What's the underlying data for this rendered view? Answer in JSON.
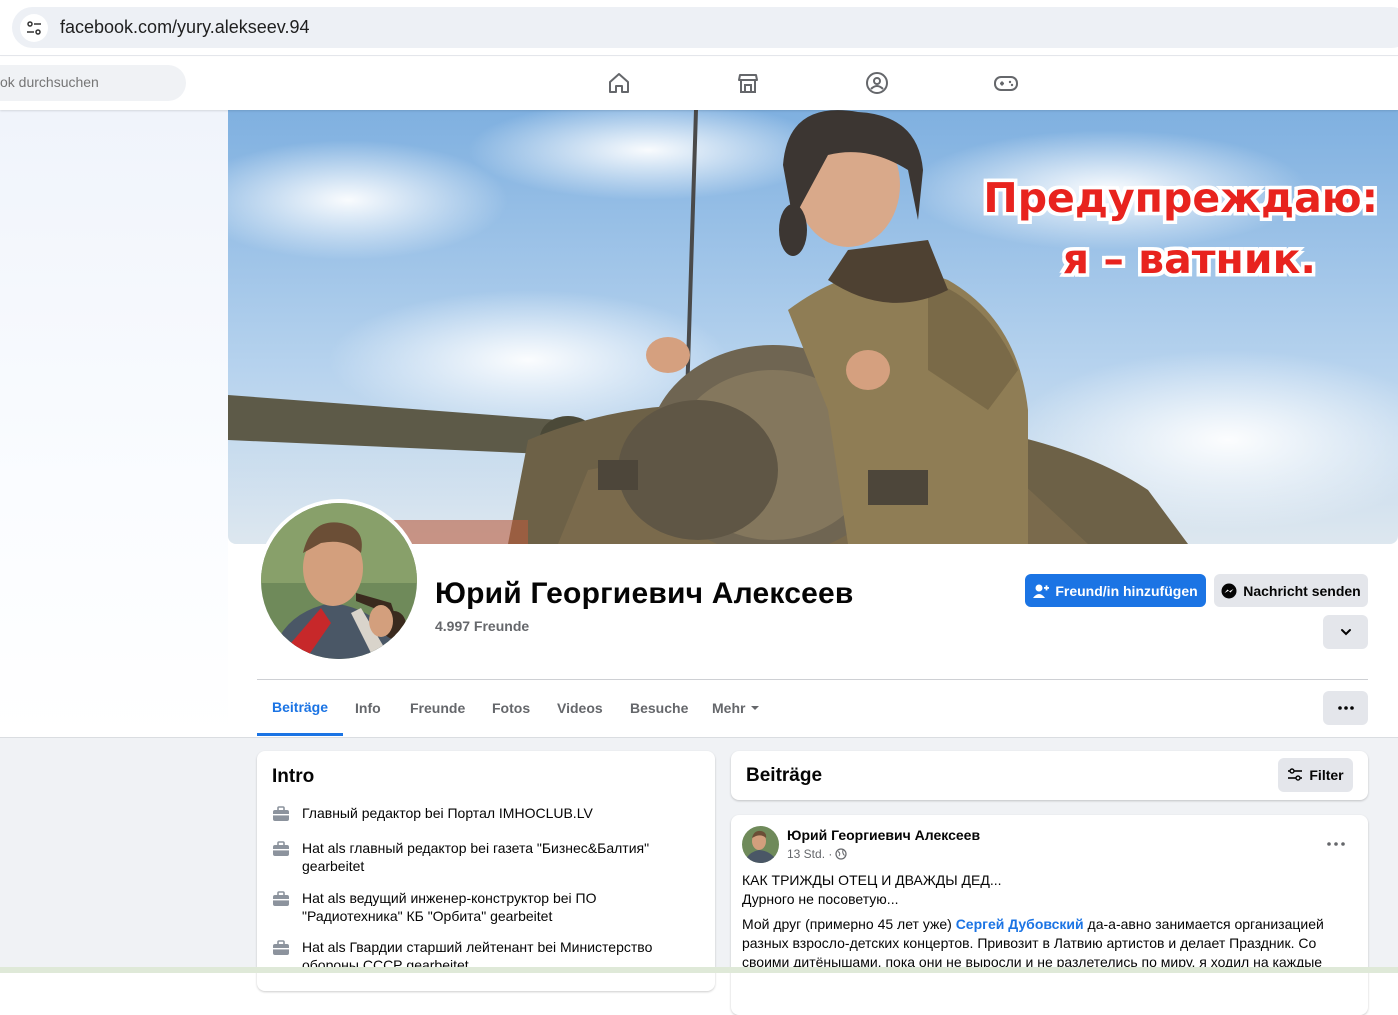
{
  "browser": {
    "url": "facebook.com/yury.alekseev.94"
  },
  "topnav": {
    "search_placeholder": "ok durchsuchen",
    "icons": [
      "home-icon",
      "marketplace-icon",
      "groups-icon",
      "gaming-icon"
    ]
  },
  "cover": {
    "line1": "Предупреждаю:",
    "line2": "я – ватник."
  },
  "profile": {
    "name": "Юрий Георгиевич Алексеев",
    "friends": "4.997 Freunde",
    "add_friend_label": "Freund/in hinzufügen",
    "message_label": "Nachricht senden"
  },
  "tabs": [
    {
      "label": "Beiträge",
      "active": true
    },
    {
      "label": "Info"
    },
    {
      "label": "Freunde"
    },
    {
      "label": "Fotos"
    },
    {
      "label": "Videos"
    },
    {
      "label": "Besuche"
    },
    {
      "label": "Mehr"
    }
  ],
  "intro": {
    "title": "Intro",
    "items": [
      "Главный редактор bei Портал IMHOCLUB.LV",
      "Hat als главный редактор bei газета \"Бизнес&Балтия\" gearbeitet",
      "Hat als ведущий инженер-конструктор bei ПО \"Радиотехника\" КБ \"Орбита\" gearbeitet",
      "Hat als Гвардии старший лейтенант bei Министерство обороны СССР gearbeitet"
    ]
  },
  "posts_header": {
    "title": "Beiträge",
    "filter_label": "Filter"
  },
  "post": {
    "author": "Юрий Георгиевич Алексеев",
    "time": "13 Std. ·",
    "line1": "КАК ТРИЖДЫ ОТЕЦ И ДВАЖДЫ ДЕД...",
    "line2": "Дурного не посоветую...",
    "body_before": "Мой друг (примерно 45 лет уже) ",
    "body_link": "Сергей Дубовский",
    "body_after": " да-а-авно занимается организацией разных взросло-детских концертов. Привозит в Латвию артистов и делает Праздник. Со своими дитёнышами, пока они не выросли и не разлетелись по миру, я ходил на каждые"
  }
}
